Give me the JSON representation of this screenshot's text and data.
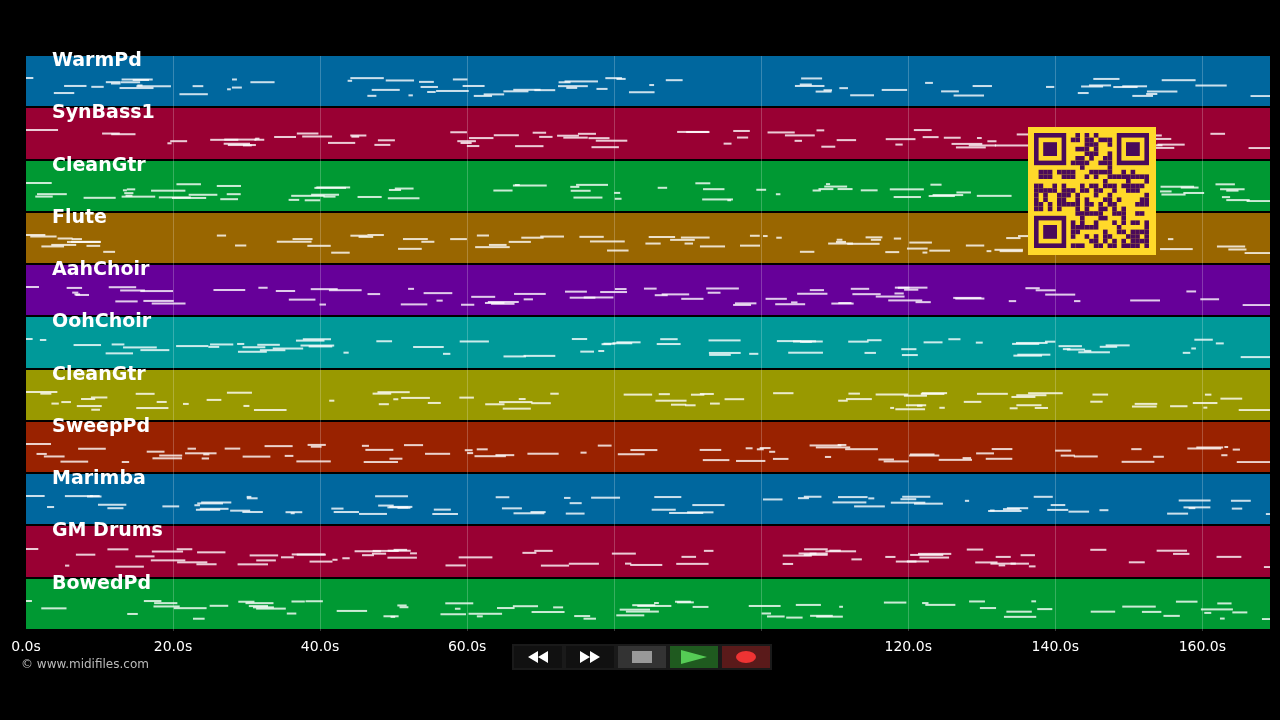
{
  "tracks": [
    {
      "name": "WarmPd",
      "color": "#00679e"
    },
    {
      "name": "SynBass1",
      "color": "#990033"
    },
    {
      "name": "CleanGtr",
      "color": "#009933"
    },
    {
      "name": "Flute",
      "color": "#996600"
    },
    {
      "name": "AahChoir",
      "color": "#660099"
    },
    {
      "name": "OohChoir",
      "color": "#009999"
    },
    {
      "name": "CleanGtr",
      "color": "#999900"
    },
    {
      "name": "SweepPd",
      "color": "#992200"
    },
    {
      "name": "Marimba",
      "color": "#00679e"
    },
    {
      "name": "GM Drums",
      "color": "#990033"
    },
    {
      "name": "BowedPd",
      "color": "#009933"
    }
  ],
  "time_axis": {
    "left_labels": [
      "0.0s",
      "20.0s",
      "40.0s",
      "60.0s"
    ],
    "right_labels": [
      "120.0s",
      "140.0s",
      "160.0s"
    ]
  },
  "credit": "© www.midifiles.com",
  "transport": [
    {
      "kind": "rewind"
    },
    {
      "kind": "forward"
    },
    {
      "kind": "stop"
    },
    {
      "kind": "play"
    },
    {
      "kind": "record"
    }
  ]
}
